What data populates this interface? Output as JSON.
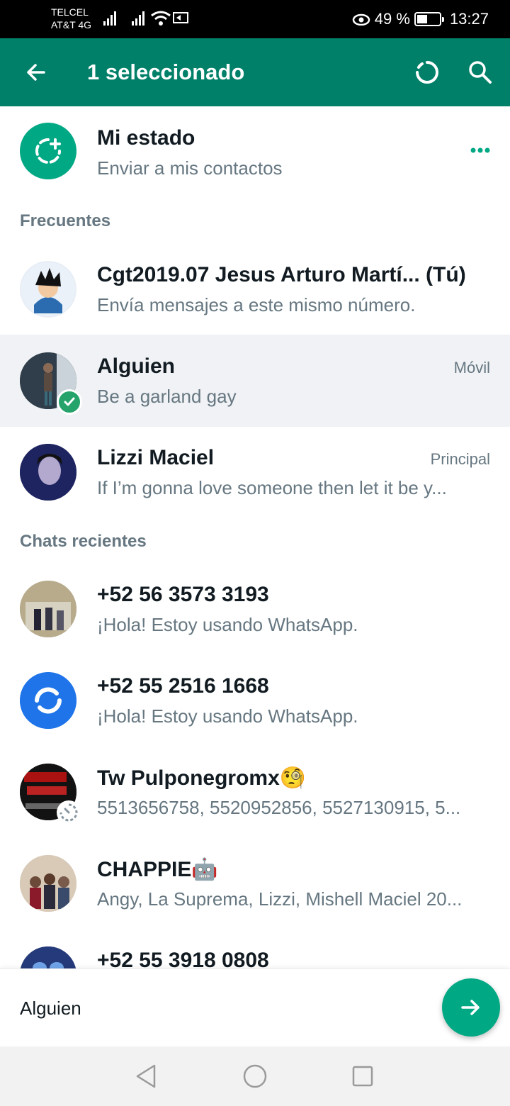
{
  "status_bar": {
    "carrier1": "TELCEL",
    "carrier2": "AT&T 4G",
    "battery_text": "49 %",
    "time": "13:27"
  },
  "app_bar": {
    "title": "1 seleccionado",
    "icons": {
      "back": "back-arrow-icon",
      "status": "circle-dashed-icon",
      "search": "search-icon"
    }
  },
  "my_status": {
    "name": "Mi estado",
    "subtitle": "Enviar a mis contactos",
    "icons": {
      "add_status": "add-status-icon",
      "more": "more-dots-icon"
    }
  },
  "sections": {
    "frequent": "Frecuentes",
    "recent": "Chats recientes"
  },
  "frequent": [
    {
      "name": "Cgt2019.07 Jesus Arturo Martí... (Tú)",
      "subtitle": "Envía mensajes a este mismo número.",
      "tag": ""
    },
    {
      "name": "Alguien",
      "subtitle": "Be a garland gay",
      "tag": "Móvil",
      "selected": true
    },
    {
      "name": "Lizzi Maciel",
      "subtitle": "If I’m gonna love someone then let it be y...",
      "tag": "Principal"
    }
  ],
  "recent": [
    {
      "name": "+52 56 3573 3193",
      "subtitle": "¡Hola! Estoy usando WhatsApp."
    },
    {
      "name": "+52 55 2516 1668",
      "subtitle": "¡Hola! Estoy usando WhatsApp."
    },
    {
      "name": "Tw Pulponegromx🧐",
      "subtitle": "5513656758, 5520952856, 5527130915, 5..."
    },
    {
      "name": "CHAPPIE🤖",
      "subtitle": "Angy, La Suprema, Lizzi, Mishell Maciel 20..."
    },
    {
      "name": "+52 55 3918 0808",
      "subtitle": ""
    }
  ],
  "selection_bar": {
    "selected_names": "Alguien"
  },
  "colors": {
    "brand": "#008069",
    "accent": "#00a884",
    "check": "#25a36a"
  }
}
